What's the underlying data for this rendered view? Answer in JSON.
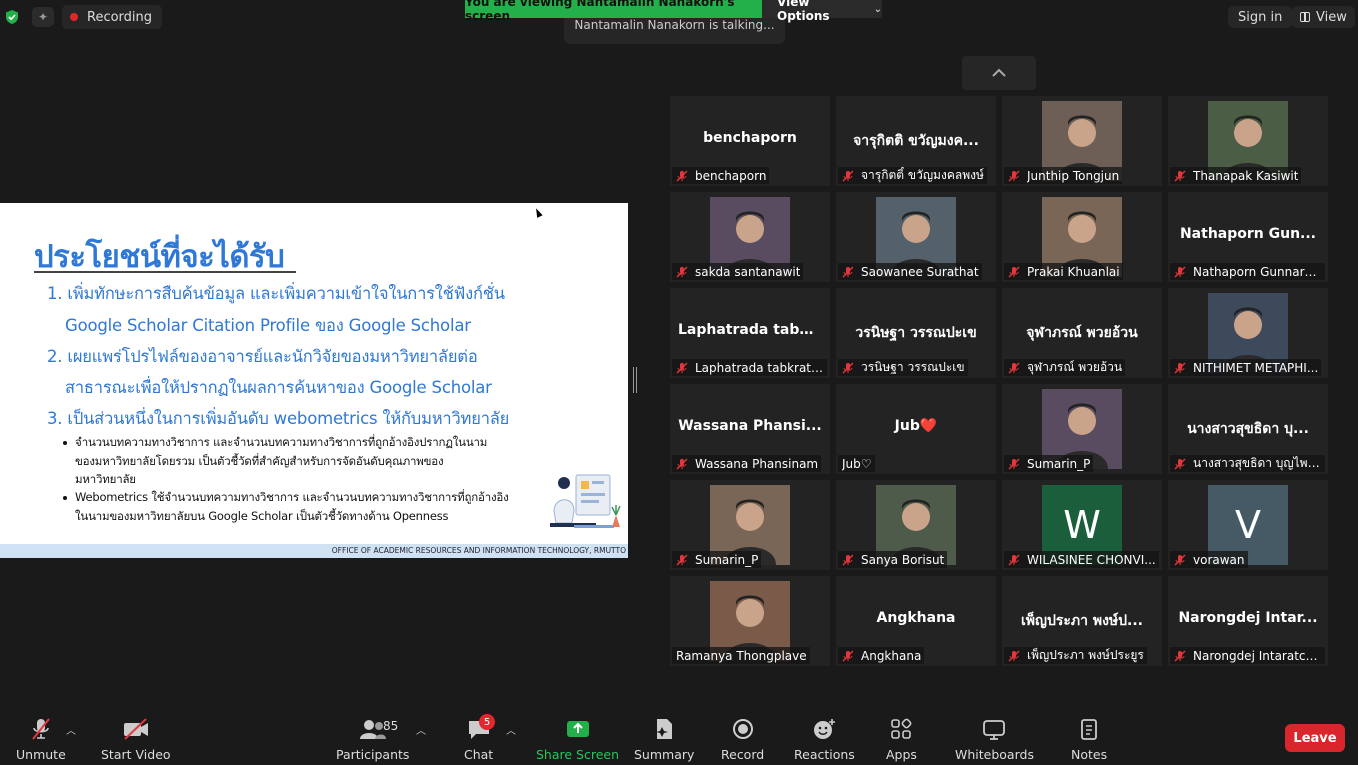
{
  "top_bar": {
    "recording_label": "Recording",
    "viewing_banner": "You are viewing Nantamalin Nanakorn's screen",
    "view_options_label": "View Options",
    "talking_text": "Nantamalin Nanakorn is talking...",
    "sign_in_label": "Sign in",
    "view_label": "View"
  },
  "slide": {
    "title": "ประโยชน์ที่จะได้รับ",
    "lines": [
      "1. เพิ่มทักษะการสืบค้นข้อมูล และเพิ่มความเข้าใจในการใช้ฟังก์ชั่น",
      "Google Scholar Citation Profile ของ Google Scholar",
      "2. เผยแพร่โปรไฟล์ของอาจารย์และนักวิจัยของมหาวิทยาลัยต่อ",
      "สาธารณะเพื่อให้ปรากฏในผลการค้นหาของ Google Scholar",
      "3. เป็นส่วนหนึ่งในการเพิ่มอันดับ webometrics ให้กับมหาวิทยาลัย"
    ],
    "bullets": [
      "จำนวนบทความทางวิชาการ และจำนวนบทความทางวิชาการที่ถูกอ้างอิงปรากฏในนาม",
      "ของมหาวิทยาลัยโดยรวม เป็นตัวชี้วัดที่สำคัญสำหรับการจัดอันดับคุณภาพของ",
      "มหาวิทยาลัย",
      "Webometrics ใช้จำนวนบทความทางวิชาการ และจำนวนบทความทางวิชาการที่ถูกอ้างอิง",
      "ในนามของมหาวิทยาลัยบน Google Scholar เป็นตัวชี้วัดทางด้าน Openness"
    ],
    "footer": "OFFICE OF ACADEMIC RESOURCES AND INFORMATION TECHNOLOGY, RMUTTO"
  },
  "participants": [
    {
      "display": "benchaporn",
      "label": "benchaporn",
      "muted": true
    },
    {
      "display": "จารุกิตติ ขวัญมงค...",
      "label": "จารุกิตติ์ ขวัญมงคลพงษ์",
      "muted": true
    },
    {
      "label": "Junthip Tongjun",
      "muted": true,
      "photo": true
    },
    {
      "label": "Thanapak Kasiwit",
      "muted": true,
      "photo": true
    },
    {
      "label": "sakda santanawit",
      "muted": true,
      "photo": true
    },
    {
      "label": "Saowanee Surathat",
      "muted": true,
      "photo": true
    },
    {
      "label": "Prakai Khuanlai",
      "muted": true,
      "photo": true
    },
    {
      "display": "Nathaporn  Gun...",
      "label": "Nathaporn Gunnarap...",
      "muted": true
    },
    {
      "display": "Laphatrada  tabk...",
      "label": "Laphatrada tabkratoke",
      "muted": true
    },
    {
      "display": "วรนิษฐา  วรรณปะเข",
      "label": "วรนิษฐา วรรณปะเข",
      "muted": true
    },
    {
      "display": "จุฬาภรณ์  พวยอ้วน",
      "label": "จุฬาภรณ์ พวยอ้วน",
      "muted": true
    },
    {
      "label": "NITHIMET METAPHI...",
      "muted": true,
      "photo": true
    },
    {
      "display": "Wassana  Phansi...",
      "label": "Wassana Phansinam",
      "muted": true
    },
    {
      "display": "Jub❤️",
      "label": "Jub♡",
      "muted": false
    },
    {
      "label": "Sumarin_P",
      "muted": true,
      "photo": true
    },
    {
      "display": "นางสาวสุขธิดา  บุ...",
      "label": "นางสาวสุขธิดา บุญไพจิตร",
      "muted": true
    },
    {
      "label": "Sumarin_P",
      "muted": true,
      "photo": true
    },
    {
      "label": "Sanya Borisut",
      "muted": true,
      "photo": true
    },
    {
      "label": "WILASINEE CHONVI...",
      "muted": true,
      "letter": "W",
      "letter_bg": "#1b5e3b"
    },
    {
      "label": "vorawan",
      "muted": true,
      "letter": "V",
      "letter_bg": "#455a64"
    },
    {
      "label": "Ramanya Thongplave",
      "muted": false,
      "photo": true
    },
    {
      "display": "Angkhana",
      "label": "Angkhana",
      "muted": true
    },
    {
      "display": "เพ็ญประภา  พงษ์ป...",
      "label": "เพ็ญประภา พงษ์ประยูร",
      "muted": true
    },
    {
      "display": "Narongdej  Intar...",
      "label": "Narongdej Intaratcha...",
      "muted": true
    }
  ],
  "toolbar": {
    "unmute": "Unmute",
    "start_video": "Start Video",
    "participants": "Participants",
    "participants_count": "85",
    "chat": "Chat",
    "chat_badge": "5",
    "share_screen": "Share Screen",
    "summary": "Summary",
    "record": "Record",
    "reactions": "Reactions",
    "apps": "Apps",
    "whiteboards": "Whiteboards",
    "notes": "Notes",
    "leave": "Leave"
  },
  "colors": {
    "accent_green": "#23b04a",
    "leave_red": "#d9262d",
    "slide_blue": "#2f78d6",
    "muted_red": "#e0383e"
  }
}
